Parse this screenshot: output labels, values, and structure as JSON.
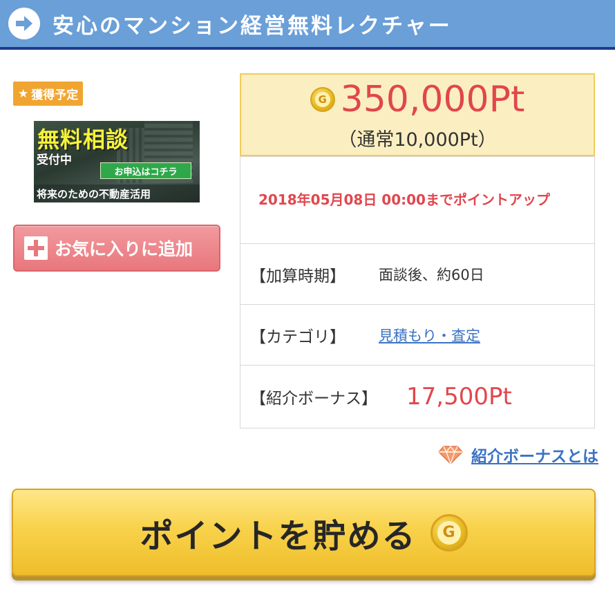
{
  "header": {
    "title": "安心のマンション経営無料レクチャー",
    "icon": "arrow-right-circle-icon",
    "bg_color": "#6a9fd8"
  },
  "badge": {
    "star": "★",
    "label": "獲得予定",
    "color": "#f0a531"
  },
  "banner": {
    "main_text": "無料相談",
    "sub_text": "受付中",
    "button_text": "お申込はコチラ",
    "footer_text": "将来のための不動産活用"
  },
  "favorite": {
    "label": "お気に入りに追加",
    "icon": "plus-icon"
  },
  "points": {
    "coin_letter": "G",
    "value": "350,000Pt",
    "normal": "（通常10,000Pt）",
    "value_color": "#e1464d"
  },
  "deadline": {
    "text": "2018年05月08日 00:00までポイントアップ"
  },
  "details": {
    "period_label": "【加算時期】",
    "period_value": "面談後、約60日",
    "category_label": "【カテゴリ】",
    "category_value": "見積もり・査定",
    "bonus_label": "【紹介ボーナス】",
    "bonus_value": "17,500Pt"
  },
  "bonus_link": {
    "label": "紹介ボーナスとは",
    "icon": "diamond-icon"
  },
  "cta": {
    "label": "ポイントを貯める",
    "coin_letter": "G"
  }
}
